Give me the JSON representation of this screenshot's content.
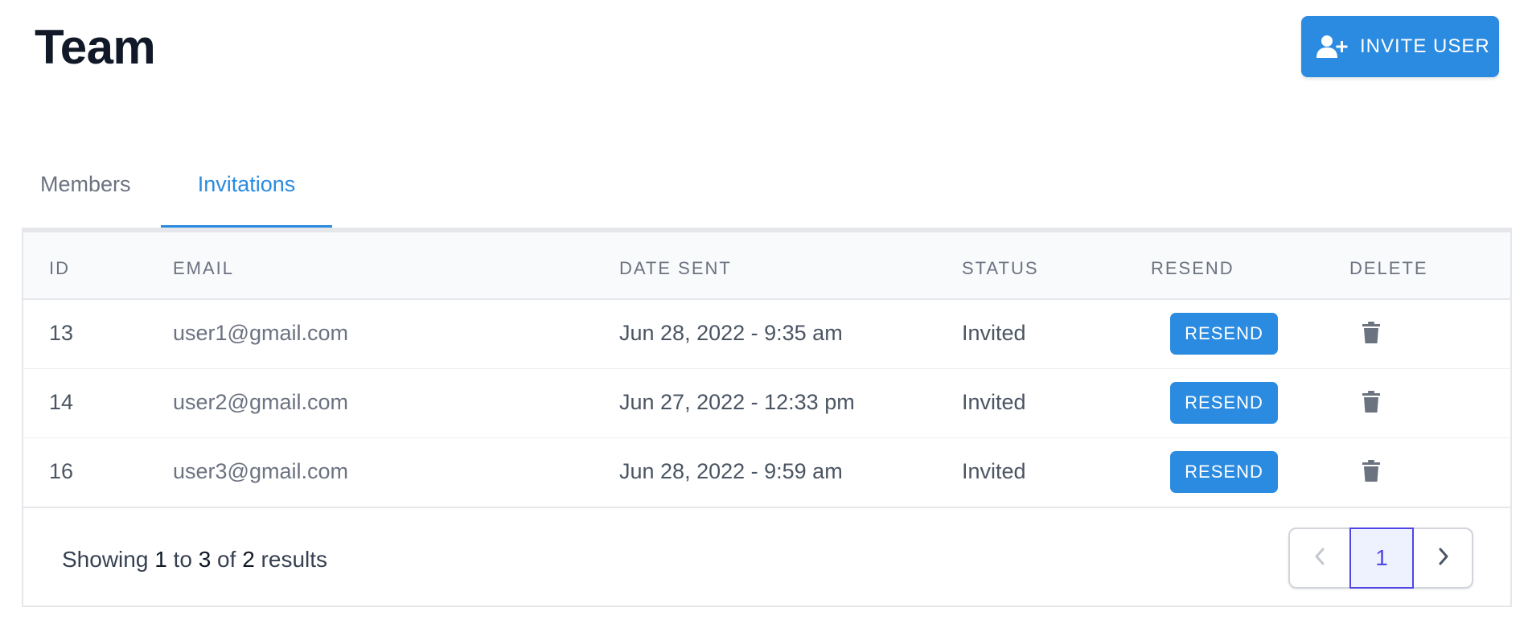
{
  "header": {
    "title": "Team",
    "invite_button": {
      "label": "INVITE USER",
      "icon": "user-plus-icon"
    }
  },
  "tabs": [
    {
      "label": "Members",
      "active": false
    },
    {
      "label": "Invitations",
      "active": true
    }
  ],
  "table": {
    "columns": [
      "ID",
      "EMAIL",
      "DATE SENT",
      "STATUS",
      "RESEND",
      "DELETE"
    ],
    "rows": [
      {
        "id": "13",
        "email": "user1@gmail.com",
        "date_sent": "Jun 28, 2022 - 9:35 am",
        "status": "Invited",
        "resend_label": "RESEND"
      },
      {
        "id": "14",
        "email": "user2@gmail.com",
        "date_sent": "Jun 27, 2022 - 12:33 pm",
        "status": "Invited",
        "resend_label": "RESEND"
      },
      {
        "id": "16",
        "email": "user3@gmail.com",
        "date_sent": "Jun 28, 2022 - 9:59 am",
        "status": "Invited",
        "resend_label": "RESEND"
      }
    ]
  },
  "footer": {
    "showing_prefix": "Showing",
    "from": "1",
    "to_word": "to",
    "to": "3",
    "of_word": "of",
    "total": "2",
    "results_word": "results"
  },
  "pagination": {
    "current_page": "1",
    "prev_icon": "chevron-left-icon",
    "next_icon": "chevron-right-icon"
  },
  "colors": {
    "accent": "#2b8be0",
    "page_active": "#4f46e5"
  }
}
